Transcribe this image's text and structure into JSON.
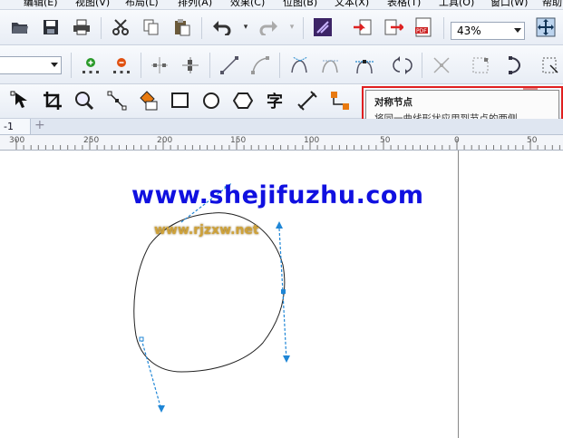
{
  "menubar": {
    "items": [
      "编辑(E)",
      "视图(V)",
      "布局(L)",
      "排列(A)",
      "效果(C)",
      "位图(B)",
      "文本(X)",
      "表格(T)",
      "工具(O)",
      "窗口(W)",
      "帮助"
    ]
  },
  "standard_toolbar": {
    "zoom_value": "43%"
  },
  "tooltip": {
    "title": "对称节点",
    "description": "将同一曲线形状应用到节点的两侧。"
  },
  "document_tab": {
    "label": "-1",
    "add_label": "+"
  },
  "ruler": {
    "labels": [
      "300",
      "250",
      "200",
      "150",
      "100",
      "50",
      "0",
      "50"
    ]
  },
  "canvas": {
    "watermark_main": "www.shejifuzhu.com",
    "watermark_secondary": "www.rjzxw.net"
  },
  "colors": {
    "highlight": "#e02020",
    "watermark_main": "#1010e0",
    "control_handle": "#1f86d6"
  },
  "icons": {
    "toolbar1": [
      "open-icon",
      "save-icon",
      "print-icon",
      "cut-icon",
      "copy-icon",
      "paste-icon",
      "undo-icon",
      "redo-icon",
      "launch-icon",
      "import-icon",
      "export-icon",
      "pdf-icon",
      "full-screen-icon"
    ],
    "toolbar2": [
      "add-node-icon",
      "delete-node-icon",
      "join-nodes-icon",
      "break-curve-icon",
      "to-line-icon",
      "to-curve-icon",
      "cusp-node-icon",
      "smooth-node-icon",
      "symmetric-node-icon",
      "reverse-direction-icon",
      "extract-subpath-icon",
      "stretch-nodes-icon",
      "rotate-nodes-icon",
      "align-nodes-icon"
    ],
    "toolbox": [
      "shape-tool-icon",
      "crop-tool-icon",
      "zoom-tool-icon",
      "curve-tool-icon",
      "smart-fill-icon",
      "rectangle-tool-icon",
      "ellipse-tool-icon",
      "polygon-tool-icon",
      "text-tool-icon",
      "dimension-tool-icon",
      "connector-tool-icon"
    ]
  }
}
